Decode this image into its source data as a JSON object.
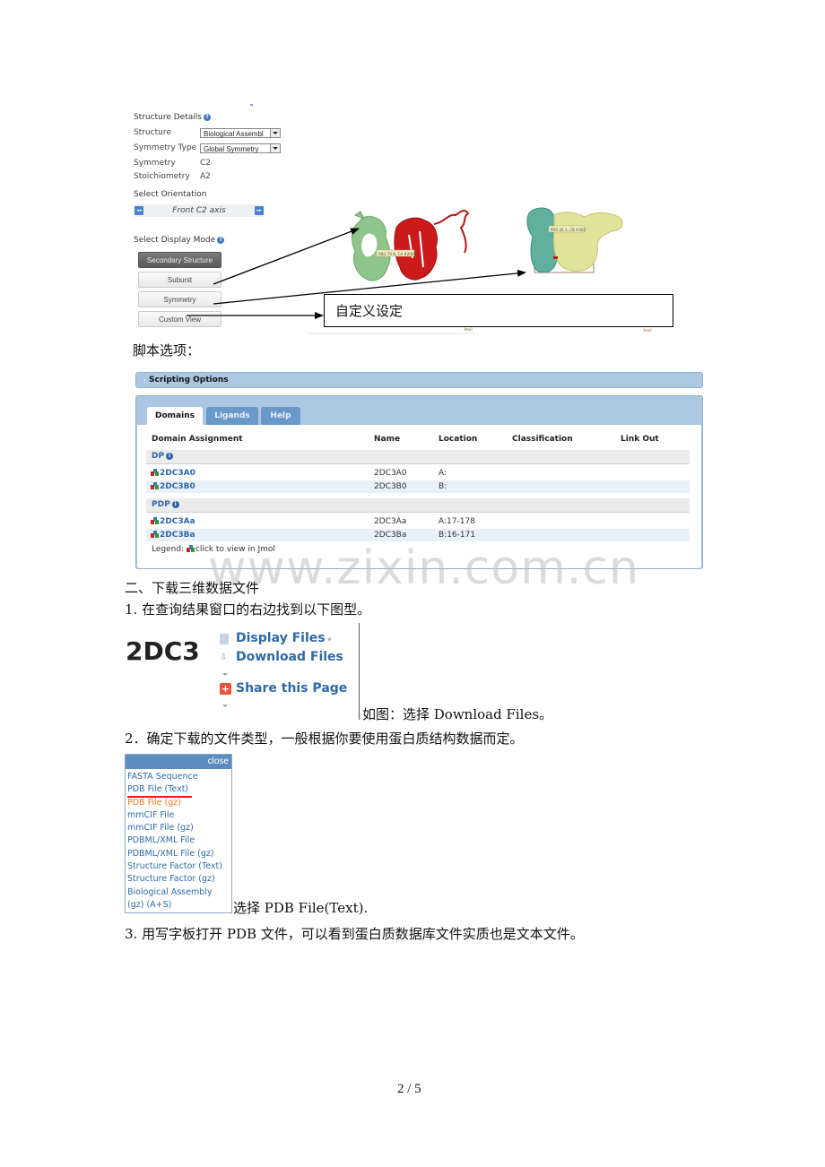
{
  "structure_details": {
    "title": "Structure Details",
    "help_icon": "question-circle-icon",
    "fields": [
      {
        "label": "Structure",
        "value": "Biological Assembl",
        "type": "select"
      },
      {
        "label": "Symmetry Type",
        "value": "Global Symmetry",
        "type": "select"
      },
      {
        "label": "Symmetry",
        "value": "C2",
        "type": "text"
      },
      {
        "label": "Stoichiometry",
        "value": "A2",
        "type": "text"
      }
    ],
    "orientation_title": "Select Orientation",
    "orientation_value": "Front C2 axis",
    "display_mode_title": "Select Display Mode",
    "display_modes": [
      {
        "label": "Secondary Structure",
        "active": true
      },
      {
        "label": "Subunit",
        "active": false
      },
      {
        "label": "Symmetry",
        "active": false
      },
      {
        "label": "Custom View",
        "active": false
      }
    ]
  },
  "viewer": {
    "label_left": "ARG 79 B, CA #2020",
    "label_right": "PRO 26 A, CB #302",
    "jmol_left": "Jmol",
    "jmol_right": "Jmol",
    "colors": {
      "green": "#8fc48a",
      "red": "#cc1a1a",
      "teal": "#5fb0a0",
      "yellow": "#e2e29a"
    }
  },
  "callout_text": "自定义设定",
  "scripting_caption": "脚本选项：",
  "scripting_options": {
    "header": "Scripting Options",
    "tabs": [
      {
        "label": "Domains",
        "active": true
      },
      {
        "label": "Ligands",
        "active": false
      },
      {
        "label": "Help",
        "active": false
      }
    ],
    "columns": [
      "Domain Assignment",
      "Name",
      "Location",
      "Classification",
      "Link Out"
    ],
    "groups": [
      {
        "label": "DP",
        "rows": [
          {
            "domain": "2DC3A0",
            "name": "2DC3A0",
            "location": "A:",
            "classification": "",
            "link_out": ""
          },
          {
            "domain": "2DC3B0",
            "name": "2DC3B0",
            "location": "B:",
            "classification": "",
            "link_out": ""
          }
        ]
      },
      {
        "label": "PDP",
        "rows": [
          {
            "domain": "2DC3Aa",
            "name": "2DC3Aa",
            "location": "A:17-178",
            "classification": "",
            "link_out": ""
          },
          {
            "domain": "2DC3Ba",
            "name": "2DC3Ba",
            "location": "B:16-171",
            "classification": "",
            "link_out": ""
          }
        ]
      }
    ],
    "legend_prefix": "Legend: ",
    "legend_text": "click to view in Jmol"
  },
  "watermark": "www.zixin.com.cn",
  "section2": {
    "heading": "二、下载三维数据文件",
    "step1": "1. 在查询结果窗口的右边找到以下图型。",
    "pdb_id": "2DC3",
    "menu": [
      "Display Files",
      "Download Files",
      "Share this Page"
    ],
    "step1_note": "如图：选择 Download Files。",
    "step2": "2．确定下载的文件类型，一般根据你要使用蛋白质结构数据而定。",
    "download_menu": {
      "close": "close",
      "items": [
        {
          "label": "FASTA Sequence",
          "highlight": false
        },
        {
          "label": "PDB File (Text)",
          "highlight": false
        },
        {
          "label": "PDB File (gz)",
          "highlight": true
        },
        {
          "label": "mmCIF File",
          "highlight": false
        },
        {
          "label": "mmCIF File (gz)",
          "highlight": false
        },
        {
          "label": "PDBML/XML File",
          "highlight": false
        },
        {
          "label": "PDBML/XML File (gz)",
          "highlight": false
        },
        {
          "label": "Structure Factor (Text)",
          "highlight": false
        },
        {
          "label": "Structure Factor (gz)",
          "highlight": false
        },
        {
          "label": "Biological Assembly",
          "highlight": false
        },
        {
          "label": "(gz) (A+S)",
          "highlight": false
        }
      ],
      "underline_color": "#e02020"
    },
    "step2_note": "选择 PDB File(Text).",
    "step3": "3. 用写字板打开 PDB 文件，可以看到蛋白质数据库文件实质也是文本文件。"
  },
  "page_number": "2 / 5"
}
